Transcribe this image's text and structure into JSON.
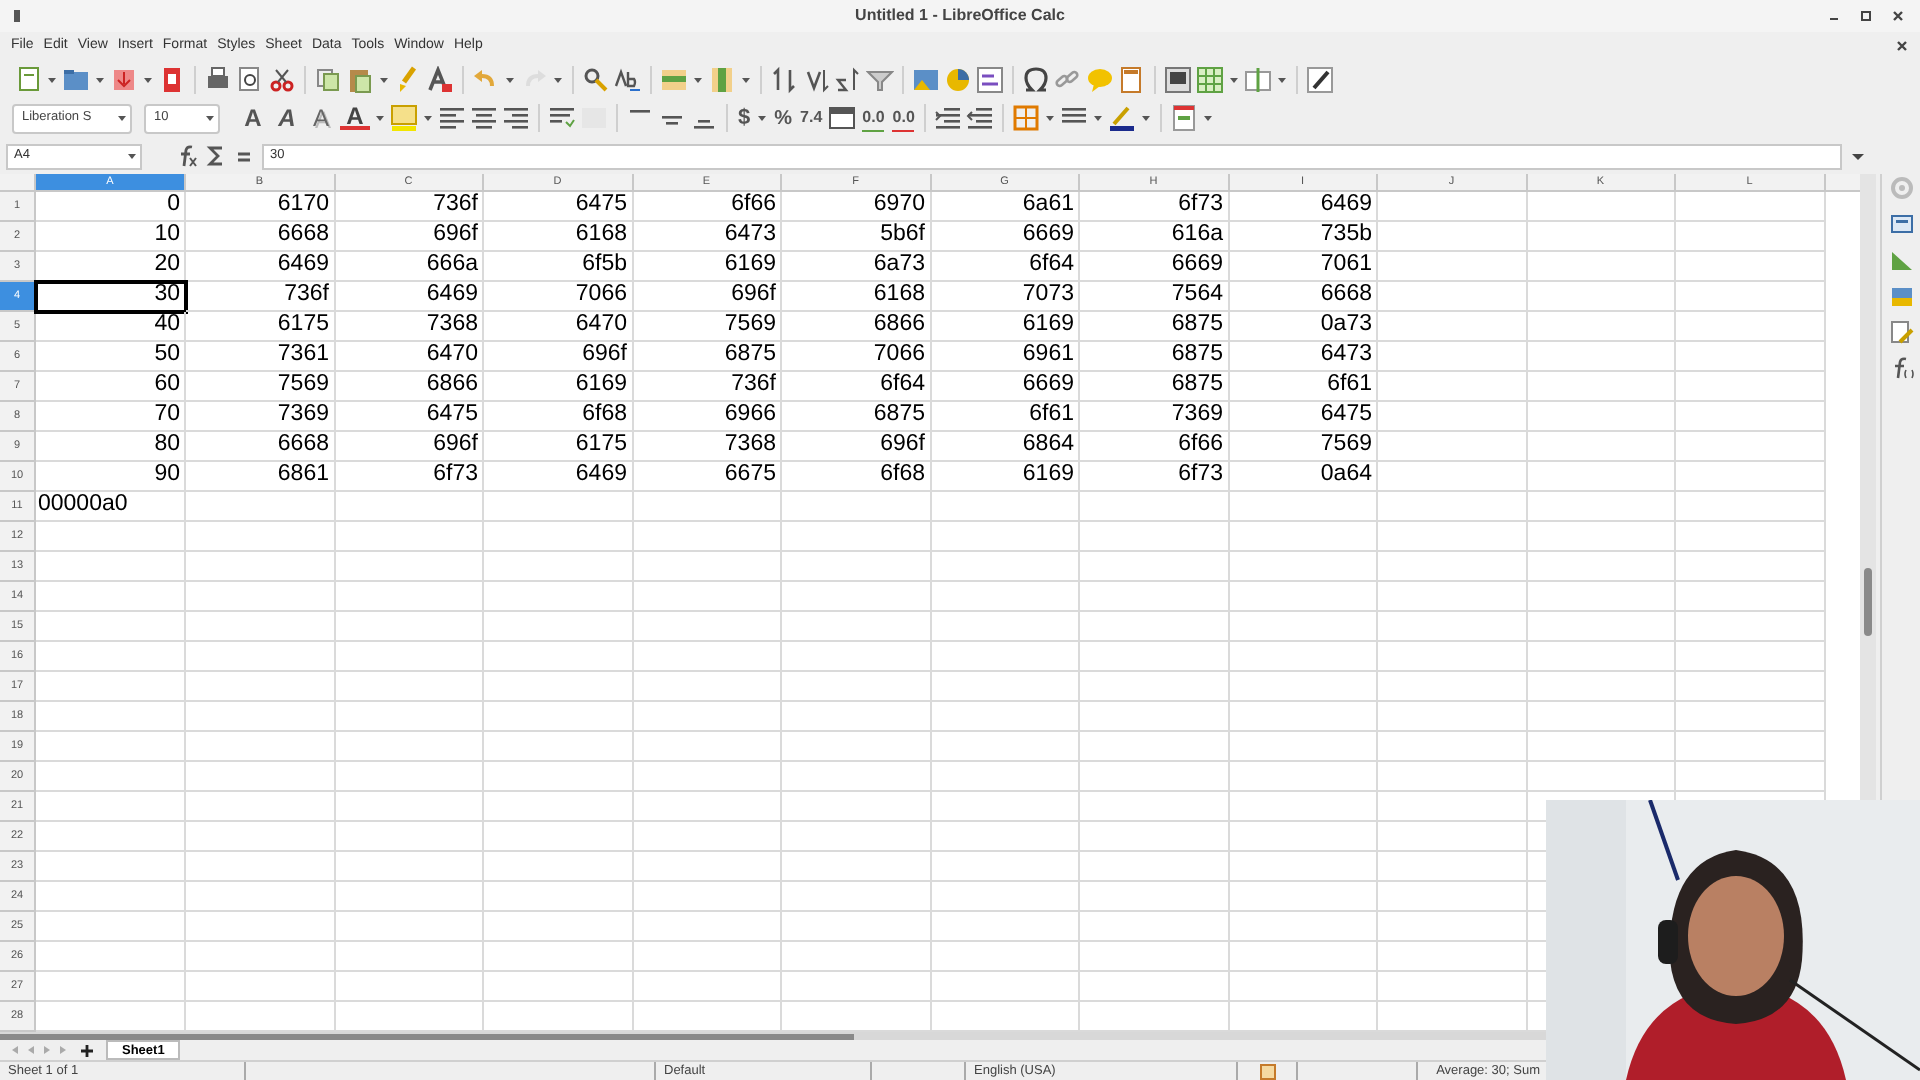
{
  "window": {
    "title": "Untitled 1 - LibreOffice Calc"
  },
  "menu": [
    "File",
    "Edit",
    "View",
    "Insert",
    "Format",
    "Styles",
    "Sheet",
    "Data",
    "Tools",
    "Window",
    "Help"
  ],
  "font_box": {
    "value": "Liberation S"
  },
  "size_box": {
    "value": "10"
  },
  "font_style_buttons": [
    {
      "text": "A",
      "kind": "bold"
    },
    {
      "text": "A",
      "kind": "italic"
    },
    {
      "text": "A",
      "kind": "shadow"
    },
    {
      "text": "A",
      "kind": "font-color"
    }
  ],
  "number_format_buttons": [
    {
      "text": "$",
      "kind": "currency"
    },
    {
      "text": "%",
      "kind": "percent"
    },
    {
      "text": "7.4",
      "kind": "number"
    },
    {
      "text": "0.0",
      "kind": "add-decimal"
    },
    {
      "text": "0.0",
      "kind": "delete-decimal"
    }
  ],
  "name_box": {
    "value": "A4"
  },
  "formula": {
    "value": "30"
  },
  "grid": {
    "columns": [
      {
        "label": "A",
        "selected": true
      },
      {
        "label": "B",
        "selected": false
      },
      {
        "label": "C",
        "selected": false
      },
      {
        "label": "D",
        "selected": false
      },
      {
        "label": "E",
        "selected": false
      },
      {
        "label": "F",
        "selected": false
      },
      {
        "label": "G",
        "selected": false
      },
      {
        "label": "H",
        "selected": false
      },
      {
        "label": "I",
        "selected": false
      },
      {
        "label": "J",
        "selected": false
      },
      {
        "label": "K",
        "selected": false
      },
      {
        "label": "L",
        "selected": false
      }
    ],
    "rows": [
      {
        "label": "1",
        "selected": false,
        "kind": "numbers",
        "cells": [
          "0",
          "6170",
          "736f",
          "6475",
          "6f66",
          "6970",
          "6a61",
          "6f73",
          "6469"
        ]
      },
      {
        "label": "2",
        "selected": false,
        "kind": "numbers",
        "cells": [
          "10",
          "6668",
          "696f",
          "6168",
          "6473",
          "5b6f",
          "6669",
          "616a",
          "735b"
        ]
      },
      {
        "label": "3",
        "selected": false,
        "kind": "numbers",
        "cells": [
          "20",
          "6469",
          "666a",
          "6f5b",
          "6169",
          "6a73",
          "6f64",
          "6669",
          "7061"
        ]
      },
      {
        "label": "4",
        "selected": true,
        "kind": "numbers",
        "cells": [
          "30",
          "736f",
          "6469",
          "7066",
          "696f",
          "6168",
          "7073",
          "7564",
          "6668"
        ]
      },
      {
        "label": "5",
        "selected": false,
        "kind": "numbers",
        "cells": [
          "40",
          "6175",
          "7368",
          "6470",
          "7569",
          "6866",
          "6169",
          "6875",
          "0a73"
        ]
      },
      {
        "label": "6",
        "selected": false,
        "kind": "numbers",
        "cells": [
          "50",
          "7361",
          "6470",
          "696f",
          "6875",
          "7066",
          "6961",
          "6875",
          "6473"
        ]
      },
      {
        "label": "7",
        "selected": false,
        "kind": "numbers",
        "cells": [
          "60",
          "7569",
          "6866",
          "6169",
          "736f",
          "6f64",
          "6669",
          "6875",
          "6f61"
        ]
      },
      {
        "label": "8",
        "selected": false,
        "kind": "numbers",
        "cells": [
          "70",
          "7369",
          "6475",
          "6f68",
          "6966",
          "6875",
          "6f61",
          "7369",
          "6475"
        ]
      },
      {
        "label": "9",
        "selected": false,
        "kind": "numbers",
        "cells": [
          "80",
          "6668",
          "696f",
          "6175",
          "7368",
          "696f",
          "6864",
          "6f66",
          "7569"
        ]
      },
      {
        "label": "10",
        "selected": false,
        "kind": "numbers",
        "cells": [
          "90",
          "6861",
          "6f73",
          "6469",
          "6675",
          "6f68",
          "6169",
          "6f73",
          "0a64"
        ]
      },
      {
        "label": "11",
        "selected": false,
        "kind": "text",
        "cells": [
          "00000a0"
        ]
      },
      {
        "label": "12",
        "selected": false
      },
      {
        "label": "13",
        "selected": false
      },
      {
        "label": "14",
        "selected": false
      },
      {
        "label": "15",
        "selected": false
      },
      {
        "label": "16",
        "selected": false
      },
      {
        "label": "17",
        "selected": false
      },
      {
        "label": "18",
        "selected": false
      },
      {
        "label": "19",
        "selected": false
      },
      {
        "label": "20",
        "selected": false
      },
      {
        "label": "21",
        "selected": false
      },
      {
        "label": "22",
        "selected": false
      },
      {
        "label": "23",
        "selected": false
      },
      {
        "label": "24",
        "selected": false
      },
      {
        "label": "25",
        "selected": false
      },
      {
        "label": "26",
        "selected": false
      },
      {
        "label": "27",
        "selected": false
      },
      {
        "label": "28",
        "selected": false
      }
    ]
  },
  "sheet_tabs": [
    {
      "label": "Sheet1",
      "selected": true
    }
  ],
  "status_bar": {
    "sheet": "Sheet 1 of 1",
    "page_style": "Default",
    "language": "English (USA)",
    "summary": "Average: 30; Sum"
  },
  "webcam": {
    "kind": "picture"
  }
}
